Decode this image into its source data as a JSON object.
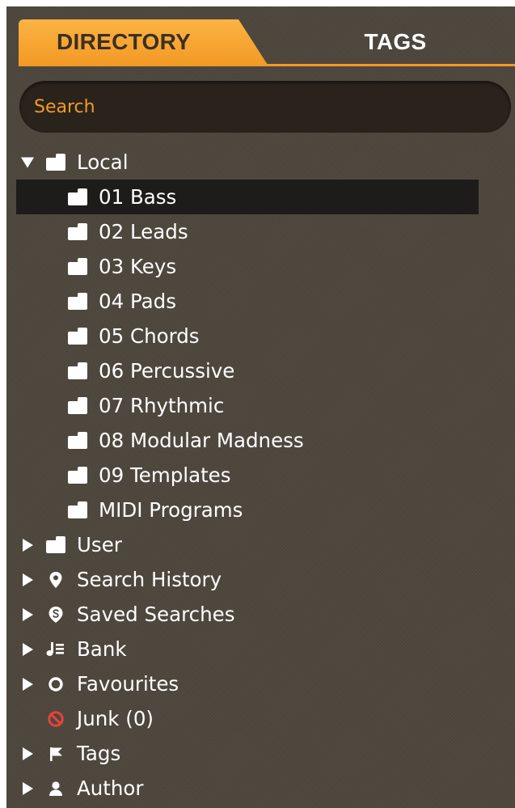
{
  "tabs": {
    "directory": "DIRECTORY",
    "tags": "TAGS"
  },
  "search": {
    "placeholder": "Search"
  },
  "colors": {
    "accent": "#f39a26",
    "panel": "#4e473d",
    "selected_row": "#1e1c1b",
    "junk_icon": "#e8423d"
  },
  "tree": {
    "local": {
      "label": "Local",
      "expanded": true,
      "icon": "folder-icon"
    },
    "local_children": [
      {
        "label": "01 Bass",
        "selected": true
      },
      {
        "label": "02 Leads"
      },
      {
        "label": "03 Keys"
      },
      {
        "label": "04 Pads"
      },
      {
        "label": "05 Chords"
      },
      {
        "label": "06 Percussive"
      },
      {
        "label": "07 Rhythmic"
      },
      {
        "label": "08 Modular Madness"
      },
      {
        "label": "09 Templates"
      },
      {
        "label": "MIDI Programs"
      }
    ],
    "user": {
      "label": "User",
      "icon": "folder-icon"
    },
    "search_history": {
      "label": "Search History",
      "icon": "location-pin-icon"
    },
    "saved_searches": {
      "label": "Saved Searches",
      "icon": "saved-search-icon"
    },
    "bank": {
      "label": "Bank",
      "icon": "bank-icon"
    },
    "favourites": {
      "label": "Favourites",
      "icon": "circle-icon"
    },
    "junk": {
      "label": "Junk (0)",
      "icon": "prohibited-icon"
    },
    "tags": {
      "label": "Tags",
      "icon": "flag-icon"
    },
    "author": {
      "label": "Author",
      "icon": "person-icon"
    }
  }
}
